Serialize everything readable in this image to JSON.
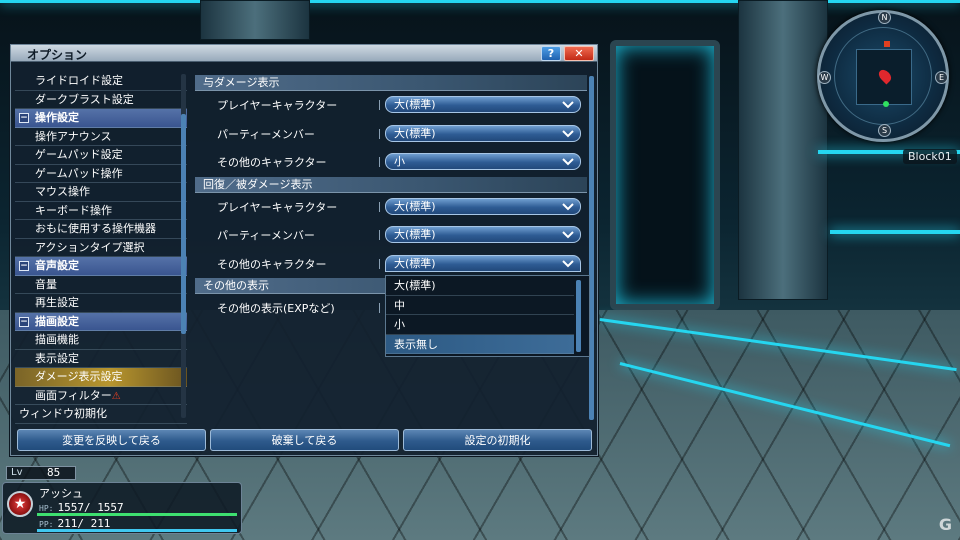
{
  "window": {
    "title": "オプション",
    "help_label": "?",
    "close_label": "✕"
  },
  "left_list": [
    {
      "label": "ライドロイド設定",
      "type": "item"
    },
    {
      "label": "ダークブラスト設定",
      "type": "item"
    },
    {
      "label": "操作設定",
      "type": "group"
    },
    {
      "label": "操作アナウンス",
      "type": "item"
    },
    {
      "label": "ゲームパッド設定",
      "type": "item"
    },
    {
      "label": "ゲームパッド操作",
      "type": "item"
    },
    {
      "label": "マウス操作",
      "type": "item"
    },
    {
      "label": "キーボード操作",
      "type": "item"
    },
    {
      "label": "おもに使用する操作機器",
      "type": "item"
    },
    {
      "label": "アクションタイプ選択",
      "type": "item"
    },
    {
      "label": "音声設定",
      "type": "group"
    },
    {
      "label": "音量",
      "type": "item"
    },
    {
      "label": "再生設定",
      "type": "item"
    },
    {
      "label": "描画設定",
      "type": "group"
    },
    {
      "label": "描画機能",
      "type": "item"
    },
    {
      "label": "表示設定",
      "type": "item"
    },
    {
      "label": "ダメージ表示設定",
      "type": "item",
      "selected": true
    },
    {
      "label": "画面フィルター",
      "type": "item",
      "warning": "⚠"
    },
    {
      "label": "ウィンドウ初期化",
      "type": "top"
    }
  ],
  "sections": {
    "deal_damage": {
      "header": "与ダメージ表示",
      "rows": [
        {
          "label": "プレイヤーキャラクター",
          "value": "大(標準)"
        },
        {
          "label": "パーティーメンバー",
          "value": "大(標準)"
        },
        {
          "label": "その他のキャラクター",
          "value": "小"
        }
      ]
    },
    "recover_damage": {
      "header": "回復／被ダメージ表示",
      "rows": [
        {
          "label": "プレイヤーキャラクター",
          "value": "大(標準)"
        },
        {
          "label": "パーティーメンバー",
          "value": "大(標準)"
        },
        {
          "label": "その他のキャラクター",
          "value": "大(標準)"
        }
      ]
    },
    "other": {
      "header": "その他の表示",
      "rows": [
        {
          "label": "その他の表示(EXPなど)"
        }
      ]
    }
  },
  "dropdown_options": [
    "大(標準)",
    "中",
    "小",
    "表示無し"
  ],
  "dropdown_highlighted": "表示無し",
  "buttons": {
    "apply": "変更を反映して戻る",
    "discard": "破棄して戻る",
    "reset": "設定の初期化"
  },
  "minimap": {
    "n": "N",
    "s": "S",
    "w": "W",
    "e": "E",
    "block": "Block01"
  },
  "hud": {
    "lv_tag": "Lv",
    "level": "85",
    "name": "アッシュ",
    "hp_tag": "HP:",
    "hp": "1557/ 1557",
    "pp_tag": "PP:",
    "pp": "211/  211",
    "hp_fraction": 1.0,
    "pp_fraction": 1.0
  },
  "watermark": "G",
  "colors": {
    "accent_cyan": "#25d6f0",
    "selected_gold": "#b8962e",
    "dropdown_blue": "#2e5c94",
    "group_blue": "#3a5590"
  }
}
